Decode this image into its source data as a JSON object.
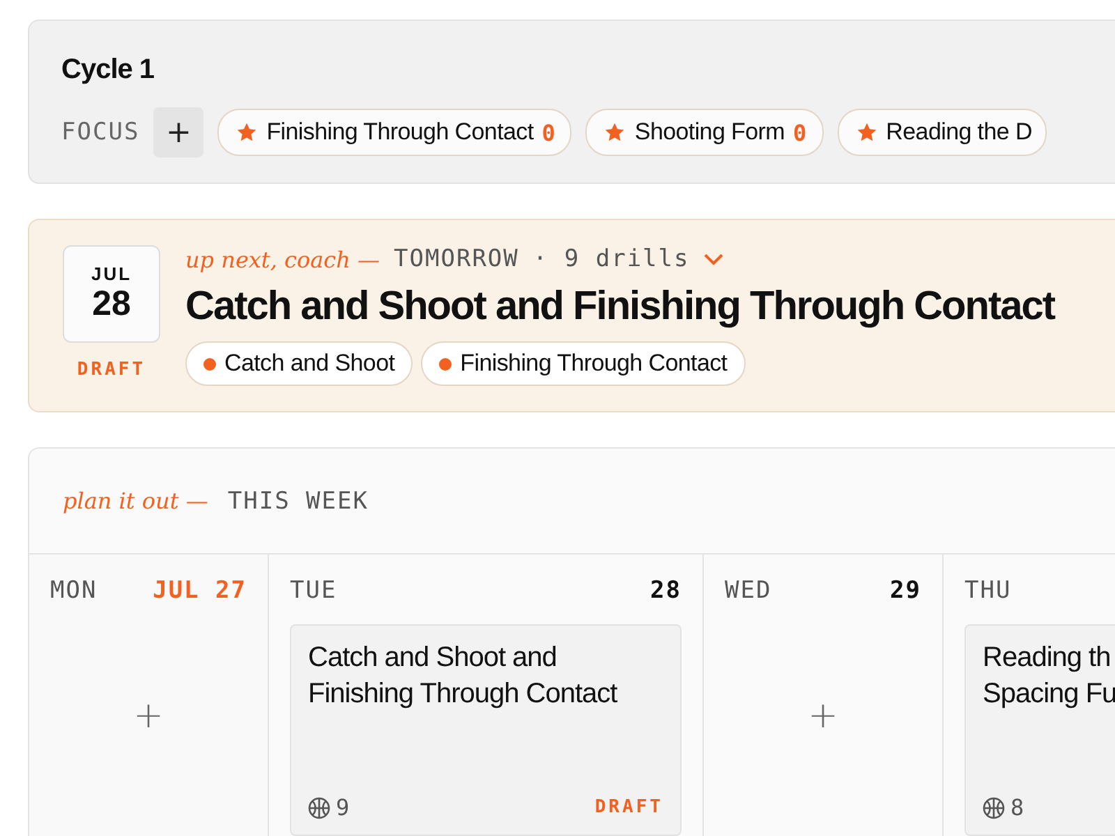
{
  "cycle": {
    "title": "Cycle 1",
    "focus_label": "FOCUS",
    "add_label": "+",
    "focus_items": [
      {
        "label": "Finishing Through Contact",
        "count": "0"
      },
      {
        "label": "Shooting Form",
        "count": "0"
      },
      {
        "label": "Reading the D"
      }
    ]
  },
  "up_next": {
    "month": "JUL",
    "day": "28",
    "status": "DRAFT",
    "kicker": "up next, coach —",
    "when": "TOMORROW",
    "drills": "· 9 drills",
    "expanded": false,
    "title": "Catch and Shoot and Finishing Through Contact",
    "tags": [
      "Catch and Shoot",
      "Finishing Through Contact"
    ]
  },
  "week": {
    "kicker": "plan it out —",
    "title": "THIS WEEK",
    "days": [
      {
        "weekday": "MON",
        "date": "JUL 27",
        "today": true,
        "add_label": "+"
      },
      {
        "weekday": "TUE",
        "date": "28",
        "today": false,
        "session": {
          "title_lines": [
            "Catch and Shoot and",
            "Finishing Through Contact"
          ],
          "drills": "9",
          "status": "DRAFT"
        }
      },
      {
        "weekday": "WED",
        "date": "29",
        "today": false,
        "add_label": "+"
      },
      {
        "weekday": "THU",
        "session": {
          "title_lines": [
            "Reading th",
            "Spacing Fu"
          ],
          "drills": "8"
        }
      }
    ]
  }
}
